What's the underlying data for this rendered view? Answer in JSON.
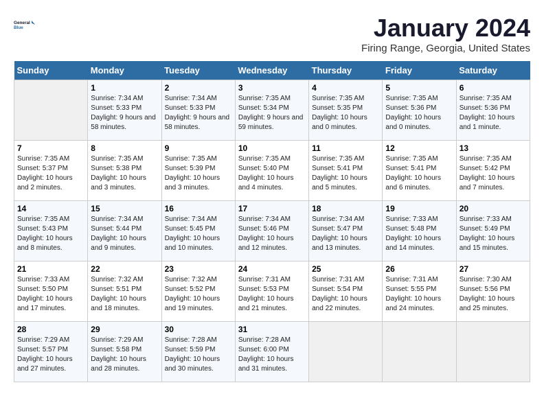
{
  "header": {
    "logo_line1": "General",
    "logo_line2": "Blue",
    "title": "January 2024",
    "location": "Firing Range, Georgia, United States"
  },
  "weekdays": [
    "Sunday",
    "Monday",
    "Tuesday",
    "Wednesday",
    "Thursday",
    "Friday",
    "Saturday"
  ],
  "weeks": [
    [
      {
        "day": "",
        "empty": true
      },
      {
        "day": "1",
        "sunrise": "7:34 AM",
        "sunset": "5:33 PM",
        "daylight": "9 hours and 58 minutes."
      },
      {
        "day": "2",
        "sunrise": "7:34 AM",
        "sunset": "5:33 PM",
        "daylight": "9 hours and 58 minutes."
      },
      {
        "day": "3",
        "sunrise": "7:35 AM",
        "sunset": "5:34 PM",
        "daylight": "9 hours and 59 minutes."
      },
      {
        "day": "4",
        "sunrise": "7:35 AM",
        "sunset": "5:35 PM",
        "daylight": "10 hours and 0 minutes."
      },
      {
        "day": "5",
        "sunrise": "7:35 AM",
        "sunset": "5:36 PM",
        "daylight": "10 hours and 0 minutes."
      },
      {
        "day": "6",
        "sunrise": "7:35 AM",
        "sunset": "5:36 PM",
        "daylight": "10 hours and 1 minute."
      }
    ],
    [
      {
        "day": "7",
        "sunrise": "7:35 AM",
        "sunset": "5:37 PM",
        "daylight": "10 hours and 2 minutes."
      },
      {
        "day": "8",
        "sunrise": "7:35 AM",
        "sunset": "5:38 PM",
        "daylight": "10 hours and 3 minutes."
      },
      {
        "day": "9",
        "sunrise": "7:35 AM",
        "sunset": "5:39 PM",
        "daylight": "10 hours and 3 minutes."
      },
      {
        "day": "10",
        "sunrise": "7:35 AM",
        "sunset": "5:40 PM",
        "daylight": "10 hours and 4 minutes."
      },
      {
        "day": "11",
        "sunrise": "7:35 AM",
        "sunset": "5:41 PM",
        "daylight": "10 hours and 5 minutes."
      },
      {
        "day": "12",
        "sunrise": "7:35 AM",
        "sunset": "5:41 PM",
        "daylight": "10 hours and 6 minutes."
      },
      {
        "day": "13",
        "sunrise": "7:35 AM",
        "sunset": "5:42 PM",
        "daylight": "10 hours and 7 minutes."
      }
    ],
    [
      {
        "day": "14",
        "sunrise": "7:35 AM",
        "sunset": "5:43 PM",
        "daylight": "10 hours and 8 minutes."
      },
      {
        "day": "15",
        "sunrise": "7:34 AM",
        "sunset": "5:44 PM",
        "daylight": "10 hours and 9 minutes."
      },
      {
        "day": "16",
        "sunrise": "7:34 AM",
        "sunset": "5:45 PM",
        "daylight": "10 hours and 10 minutes."
      },
      {
        "day": "17",
        "sunrise": "7:34 AM",
        "sunset": "5:46 PM",
        "daylight": "10 hours and 12 minutes."
      },
      {
        "day": "18",
        "sunrise": "7:34 AM",
        "sunset": "5:47 PM",
        "daylight": "10 hours and 13 minutes."
      },
      {
        "day": "19",
        "sunrise": "7:33 AM",
        "sunset": "5:48 PM",
        "daylight": "10 hours and 14 minutes."
      },
      {
        "day": "20",
        "sunrise": "7:33 AM",
        "sunset": "5:49 PM",
        "daylight": "10 hours and 15 minutes."
      }
    ],
    [
      {
        "day": "21",
        "sunrise": "7:33 AM",
        "sunset": "5:50 PM",
        "daylight": "10 hours and 17 minutes."
      },
      {
        "day": "22",
        "sunrise": "7:32 AM",
        "sunset": "5:51 PM",
        "daylight": "10 hours and 18 minutes."
      },
      {
        "day": "23",
        "sunrise": "7:32 AM",
        "sunset": "5:52 PM",
        "daylight": "10 hours and 19 minutes."
      },
      {
        "day": "24",
        "sunrise": "7:31 AM",
        "sunset": "5:53 PM",
        "daylight": "10 hours and 21 minutes."
      },
      {
        "day": "25",
        "sunrise": "7:31 AM",
        "sunset": "5:54 PM",
        "daylight": "10 hours and 22 minutes."
      },
      {
        "day": "26",
        "sunrise": "7:31 AM",
        "sunset": "5:55 PM",
        "daylight": "10 hours and 24 minutes."
      },
      {
        "day": "27",
        "sunrise": "7:30 AM",
        "sunset": "5:56 PM",
        "daylight": "10 hours and 25 minutes."
      }
    ],
    [
      {
        "day": "28",
        "sunrise": "7:29 AM",
        "sunset": "5:57 PM",
        "daylight": "10 hours and 27 minutes."
      },
      {
        "day": "29",
        "sunrise": "7:29 AM",
        "sunset": "5:58 PM",
        "daylight": "10 hours and 28 minutes."
      },
      {
        "day": "30",
        "sunrise": "7:28 AM",
        "sunset": "5:59 PM",
        "daylight": "10 hours and 30 minutes."
      },
      {
        "day": "31",
        "sunrise": "7:28 AM",
        "sunset": "6:00 PM",
        "daylight": "10 hours and 31 minutes."
      },
      {
        "day": "",
        "empty": true
      },
      {
        "day": "",
        "empty": true
      },
      {
        "day": "",
        "empty": true
      }
    ]
  ]
}
